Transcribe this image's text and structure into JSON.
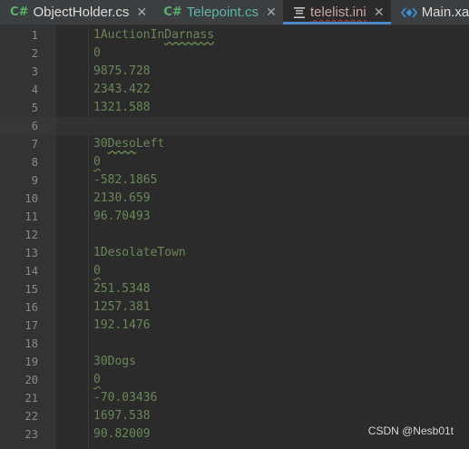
{
  "tabs": [
    {
      "icon": "C#",
      "icon_name": "csharp-file-icon",
      "title": "ObjectHolder.cs",
      "close": "✕",
      "active": false,
      "style": "plain"
    },
    {
      "icon": "C#",
      "icon_name": "csharp-file-icon",
      "title": "Telepoint.cs",
      "close": "✕",
      "active": false,
      "style": "teal"
    },
    {
      "icon": "≡",
      "icon_name": "text-file-icon",
      "title": "telelist.ini",
      "close": "✕",
      "active": true,
      "style": "red"
    },
    {
      "icon": "<◆>",
      "icon_name": "xaml-file-icon",
      "title": "Main.xa",
      "close": "",
      "active": false,
      "style": "plain"
    }
  ],
  "editor": {
    "current_line": 6,
    "lines": [
      {
        "num": "1",
        "text": "1AuctionInDarnass"
      },
      {
        "num": "2",
        "text": "0"
      },
      {
        "num": "3",
        "text": "9875.728"
      },
      {
        "num": "4",
        "text": "2343.422"
      },
      {
        "num": "5",
        "text": "1321.588"
      },
      {
        "num": "6",
        "text": ""
      },
      {
        "num": "7",
        "text": "30DesoLeft"
      },
      {
        "num": "8",
        "text": "0"
      },
      {
        "num": "9",
        "text": "-582.1865"
      },
      {
        "num": "10",
        "text": "2130.659"
      },
      {
        "num": "11",
        "text": "96.70493"
      },
      {
        "num": "12",
        "text": ""
      },
      {
        "num": "13",
        "text": "1DesolateTown"
      },
      {
        "num": "14",
        "text": "0"
      },
      {
        "num": "15",
        "text": "251.5348"
      },
      {
        "num": "16",
        "text": "1257.381"
      },
      {
        "num": "17",
        "text": "192.1476"
      },
      {
        "num": "18",
        "text": ""
      },
      {
        "num": "19",
        "text": "30Dogs"
      },
      {
        "num": "20",
        "text": "0"
      },
      {
        "num": "21",
        "text": "-70.03436"
      },
      {
        "num": "22",
        "text": "1697.538"
      },
      {
        "num": "23",
        "text": "90.82009"
      }
    ]
  },
  "watermark": "CSDN @Nesb01t",
  "colors": {
    "background": "#2b2b2b",
    "gutter": "#313335",
    "string_green": "#6a8759",
    "active_tab_underline": "#4a88c7",
    "csharp_icon": "#57b36c"
  }
}
